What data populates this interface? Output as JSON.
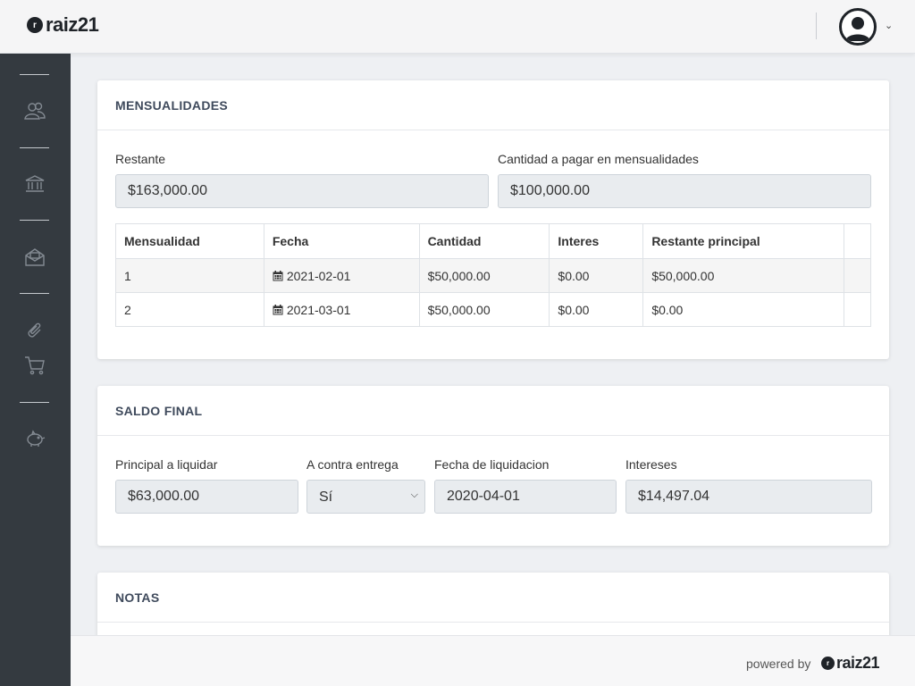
{
  "header": {
    "logo_mark": "r",
    "logo_text": "raiz21"
  },
  "sidebar": {
    "icons": [
      "users-icon",
      "bank-icon",
      "mail-icon",
      "paperclip-icon",
      "cart-icon",
      "piggy-bank-icon"
    ]
  },
  "mensualidades": {
    "title": "MENSUALIDADES",
    "restante_label": "Restante",
    "restante_value": "$163,000.00",
    "cantidad_label": "Cantidad a pagar en mensualidades",
    "cantidad_value": "$100,000.00",
    "columns": [
      "Mensualidad",
      "Fecha",
      "Cantidad",
      "Interes",
      "Restante principal"
    ],
    "rows": [
      {
        "n": "1",
        "fecha": "2021-02-01",
        "cantidad": "$50,000.00",
        "interes": "$0.00",
        "restante": "$50,000.00"
      },
      {
        "n": "2",
        "fecha": "2021-03-01",
        "cantidad": "$50,000.00",
        "interes": "$0.00",
        "restante": "$0.00"
      }
    ]
  },
  "saldo_final": {
    "title": "SALDO FINAL",
    "principal_label": "Principal a liquidar",
    "principal_value": "$63,000.00",
    "contra_label": "A contra entrega",
    "contra_value": "Sí",
    "fecha_label": "Fecha de liquidacion",
    "fecha_value": "2020-04-01",
    "intereses_label": "Intereses",
    "intereses_value": "$14,497.04"
  },
  "notas": {
    "title": "NOTAS"
  },
  "footer": {
    "powered_by": "powered by",
    "logo_mark": "r",
    "logo_text": "raiz21"
  },
  "colors": {
    "sidebar_bg": "#343a40",
    "card_title": "#3f4a5c",
    "field_bg": "#e9ecef"
  }
}
